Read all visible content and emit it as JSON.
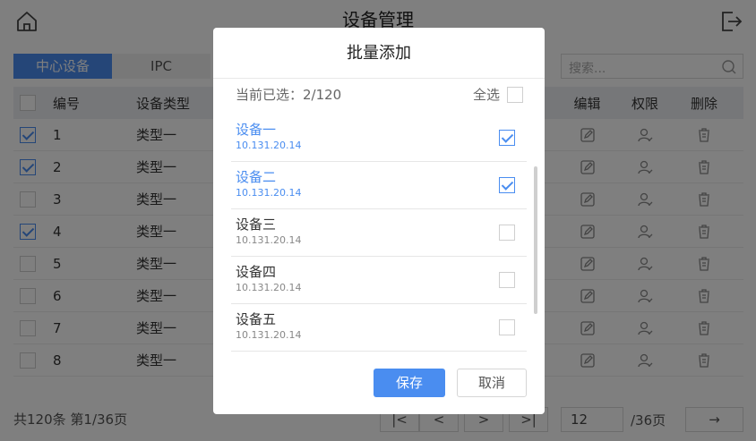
{
  "header": {
    "title": "设备管理"
  },
  "tabs": [
    {
      "label": "中心设备",
      "active": true
    },
    {
      "label": "IPC",
      "active": false
    }
  ],
  "search": {
    "placeholder": "搜索..."
  },
  "table": {
    "columns": {
      "id": "编号",
      "type": "设备类型",
      "edit": "编辑",
      "permission": "权限",
      "delete": "删除"
    },
    "rows": [
      {
        "id": "1",
        "type": "类型一",
        "checked": true
      },
      {
        "id": "2",
        "type": "类型一",
        "checked": true
      },
      {
        "id": "3",
        "type": "类型一",
        "checked": false
      },
      {
        "id": "4",
        "type": "类型一",
        "checked": true
      },
      {
        "id": "5",
        "type": "类型一",
        "checked": false
      },
      {
        "id": "6",
        "type": "类型一",
        "checked": false
      },
      {
        "id": "7",
        "type": "类型一",
        "checked": false
      },
      {
        "id": "8",
        "type": "类型一",
        "checked": false
      }
    ]
  },
  "footer": {
    "total": "共120条 第1/36页",
    "first": "|<",
    "prev": "<",
    "next": ">",
    "last": ">|",
    "page_input": "12",
    "page_suffix": "/36页",
    "go": "→"
  },
  "modal": {
    "title": "批量添加",
    "selected_info": "当前已选：2/120",
    "select_all": "全选",
    "items": [
      {
        "name": "设备一",
        "ip": "10.131.20.14",
        "checked": true
      },
      {
        "name": "设备二",
        "ip": "10.131.20.14",
        "checked": true
      },
      {
        "name": "设备三",
        "ip": "10.131.20.14",
        "checked": false
      },
      {
        "name": "设备四",
        "ip": "10.131.20.14",
        "checked": false
      },
      {
        "name": "设备五",
        "ip": "10.131.20.14",
        "checked": false
      }
    ],
    "save": "保存",
    "cancel": "取消"
  },
  "colors": {
    "accent": "#4a8df0",
    "overlay": "rgba(0,0,0,0.5)"
  }
}
